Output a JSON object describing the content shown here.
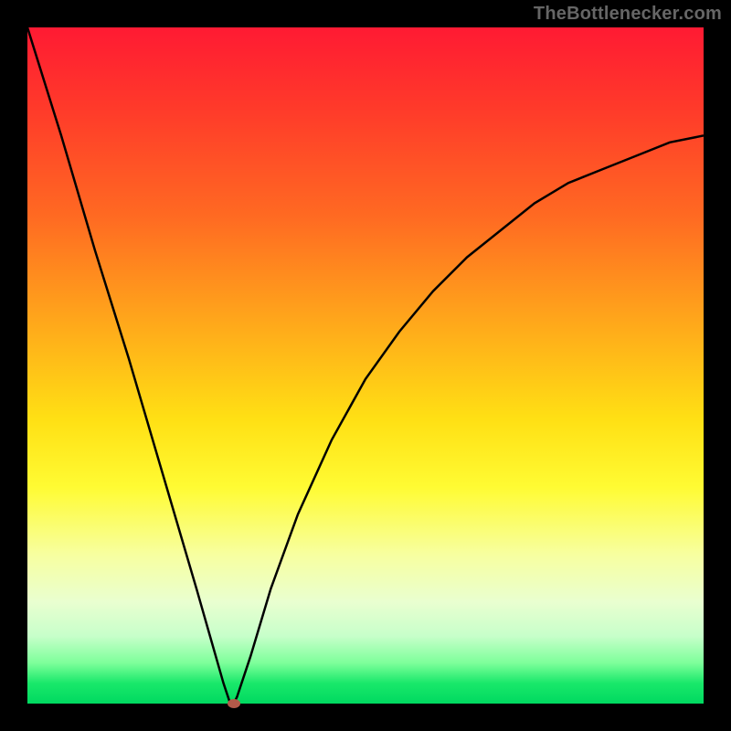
{
  "watermark": "TheBottlenecker.com",
  "chart_data": {
    "type": "line",
    "title": "",
    "xlabel": "",
    "ylabel": "",
    "xlim": [
      0,
      1
    ],
    "ylim": [
      0,
      100
    ],
    "x": [
      0.0,
      0.05,
      0.1,
      0.15,
      0.2,
      0.25,
      0.27,
      0.29,
      0.3,
      0.305,
      0.31,
      0.33,
      0.36,
      0.4,
      0.45,
      0.5,
      0.55,
      0.6,
      0.65,
      0.7,
      0.75,
      0.8,
      0.85,
      0.9,
      0.95,
      1.0
    ],
    "values": [
      100,
      84,
      67,
      51,
      34,
      17,
      10,
      3,
      0,
      0,
      1,
      7,
      17,
      28,
      39,
      48,
      55,
      61,
      66,
      70,
      74,
      77,
      79,
      81,
      83,
      84
    ],
    "marker": {
      "x": 0.305,
      "y": 0
    },
    "colors": {
      "top": "#ff1a33",
      "bottom": "#00d960",
      "curve": "#000000",
      "marker": "#b35a4a",
      "frame": "#000000"
    }
  }
}
